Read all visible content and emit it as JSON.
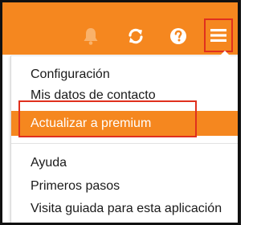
{
  "colors": {
    "accent": "#f5871f",
    "annotation": "#e0301e",
    "icon": "#ffffff"
  },
  "topbar": {
    "icons": [
      "bell-icon",
      "refresh-icon",
      "help-icon",
      "hamburger-menu-icon"
    ]
  },
  "menu": {
    "items": [
      {
        "label": "Configuración"
      },
      {
        "label": "Mis datos de contacto"
      },
      {
        "label": "Actualizar a premium",
        "highlighted": true
      },
      {
        "label": "Ayuda"
      },
      {
        "label": "Primeros pasos"
      },
      {
        "label": "Visita guiada para esta aplicación"
      }
    ]
  }
}
